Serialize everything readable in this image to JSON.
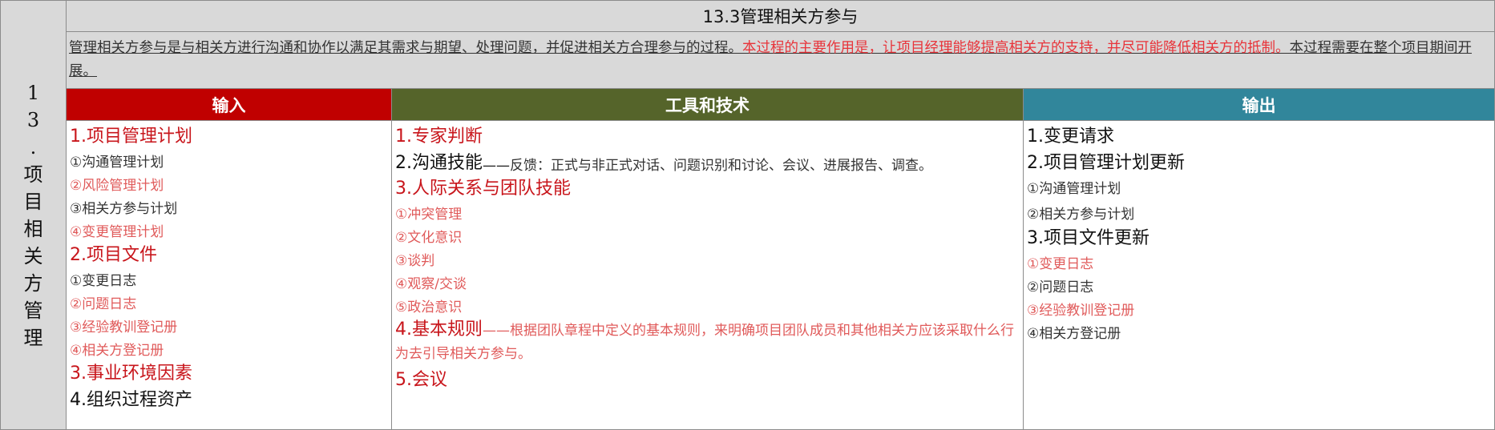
{
  "side_label": [
    "1",
    "3",
    ".",
    "项",
    "目",
    "相",
    "关",
    "方",
    "管",
    "理"
  ],
  "title": "13.3管理相关方参与",
  "description": {
    "plain_1": "管理相关方参与是与相关方进行沟通和协作以满足其需求与期望、处理问题，并促进相关方合理参与的过程。",
    "highlight": "本过程的主要作用是，让项目经理能够提高相关方的支持，并尽可能降低相关方的抵制。",
    "plain_2": "本过程需要在整个项目期间开展。"
  },
  "headers": {
    "inputs": "输入",
    "tools": "工具和技术",
    "outputs": "输出"
  },
  "inputs": [
    {
      "text": "1.项目管理计划",
      "size": "lg",
      "color": "red"
    },
    {
      "text": "①沟通管理计划",
      "size": "sm",
      "color": "dark"
    },
    {
      "text": "②风险管理计划",
      "size": "sm",
      "color": "pink"
    },
    {
      "text": "③相关方参与计划",
      "size": "sm",
      "color": "dark"
    },
    {
      "text": "④变更管理计划",
      "size": "sm",
      "color": "pink"
    },
    {
      "text": "2.项目文件",
      "size": "lg",
      "color": "red"
    },
    {
      "text": "①变更日志",
      "size": "sm",
      "color": "dark"
    },
    {
      "text": "②问题日志",
      "size": "sm",
      "color": "pink"
    },
    {
      "text": "③经验教训登记册",
      "size": "sm",
      "color": "pink"
    },
    {
      "text": "④相关方登记册",
      "size": "sm",
      "color": "pink"
    },
    {
      "text": "3.事业环境因素",
      "size": "lg",
      "color": "red"
    },
    {
      "text": "4.组织过程资产",
      "size": "lg",
      "color": "dark"
    }
  ],
  "tools": {
    "expert": "1.专家判断",
    "comm_lead": "2.沟通技能",
    "comm_dash": "——",
    "comm_detail": "反馈：正式与非正式对话、问题识别和讨论、会议、进展报告、调查。",
    "interpersonal": "3.人际关系与团队技能",
    "sub": [
      "①冲突管理",
      "②文化意识",
      "③谈判",
      "④观察/交谈",
      "⑤政治意识"
    ],
    "rules_lead": "4.基本规则",
    "rules_detail": "——根据团队章程中定义的基本规则，来明确项目团队成员和其他相关方应该采取什么行为去引导相关方参与。",
    "meeting": "5.会议"
  },
  "outputs": [
    {
      "text": "1.变更请求",
      "size": "lg",
      "color": "dark"
    },
    {
      "text": "2.项目管理计划更新",
      "size": "lg",
      "color": "dark"
    },
    {
      "text": "①沟通管理计划",
      "size": "sm",
      "color": "dark"
    },
    {
      "text": "②相关方参与计划",
      "size": "sm",
      "color": "dark"
    },
    {
      "text": "3.项目文件更新",
      "size": "lg",
      "color": "dark"
    },
    {
      "text": "①变更日志",
      "size": "sm",
      "color": "pink"
    },
    {
      "text": "②问题日志",
      "size": "sm",
      "color": "dark"
    },
    {
      "text": "③经验教训登记册",
      "size": "sm",
      "color": "pink"
    },
    {
      "text": "④相关方登记册",
      "size": "sm",
      "color": "dark"
    }
  ]
}
